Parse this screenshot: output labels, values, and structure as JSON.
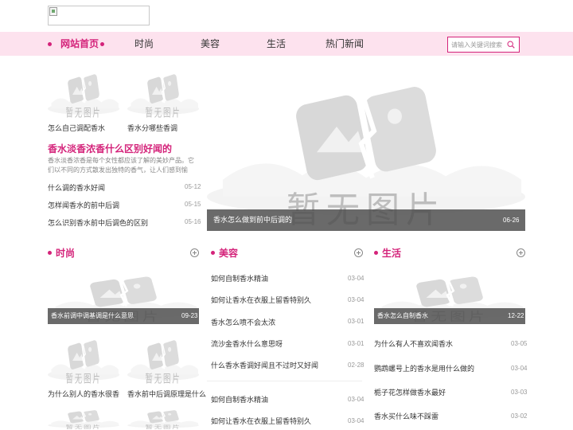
{
  "nav": {
    "items": [
      "网站首页",
      "时尚",
      "美容",
      "生活",
      "热门新闻"
    ],
    "search_placeholder": "请输入关键词搜索"
  },
  "placeholder_text": "暂无图片",
  "top_left": {
    "thumbs": [
      "怎么自己调配香水",
      "香水分哪些香调"
    ],
    "feature_title": "香水淡香浓香什么区别好闻的",
    "feature_desc": "香水淡香浓香是每个女性都应该了解的美妙产品。它们以不同的方式散发出独特的香气，让人们感到愉悦。但是，对于许...",
    "list": [
      {
        "title": "什么调的香水好闻",
        "date": "05-12"
      },
      {
        "title": "怎样闻香水的前中后调",
        "date": "05-15"
      },
      {
        "title": "怎么识别香水前中后调色的区别",
        "date": "05-16"
      }
    ]
  },
  "banner": {
    "title": "香水怎么做到前中后调的",
    "date": "06-26"
  },
  "sections": {
    "fashion": {
      "title": "时尚",
      "featured": {
        "title": "香水前调中调基调是什么意思",
        "date": "09-23"
      },
      "thumbs": [
        "为什么别人的香水很香",
        "香水前中后调原理是什么"
      ]
    },
    "beauty": {
      "title": "美容",
      "list1": [
        {
          "title": "如何自制香水精油",
          "date": "03-04"
        },
        {
          "title": "如何让香水在衣服上留香特别久",
          "date": "03-04"
        },
        {
          "title": "香水怎么喷不会太浓",
          "date": "03-01"
        },
        {
          "title": "流沙金香水什么意思呀",
          "date": "03-01"
        },
        {
          "title": "什么香水香调好闻且不过时又好闻",
          "date": "02-28"
        }
      ],
      "list2": [
        {
          "title": "如何自制香水精油",
          "date": "03-04"
        },
        {
          "title": "如何让香水在衣服上留香特别久",
          "date": "03-04"
        }
      ]
    },
    "life": {
      "title": "生活",
      "featured": {
        "title": "香水怎么自制香水",
        "date": "12-22"
      },
      "list": [
        {
          "title": "为什么有人不喜欢闻香水",
          "date": "03-05"
        },
        {
          "title": "鹦鹉螺号上的香水是用什么做的",
          "date": "03-04"
        },
        {
          "title": "栀子花怎样做香水最好",
          "date": "03-03"
        },
        {
          "title": "香水买什么味不踩雷",
          "date": "03-02"
        }
      ]
    }
  },
  "colors": {
    "accent": "#d4237a",
    "nav_bg": "#fde2ee"
  }
}
